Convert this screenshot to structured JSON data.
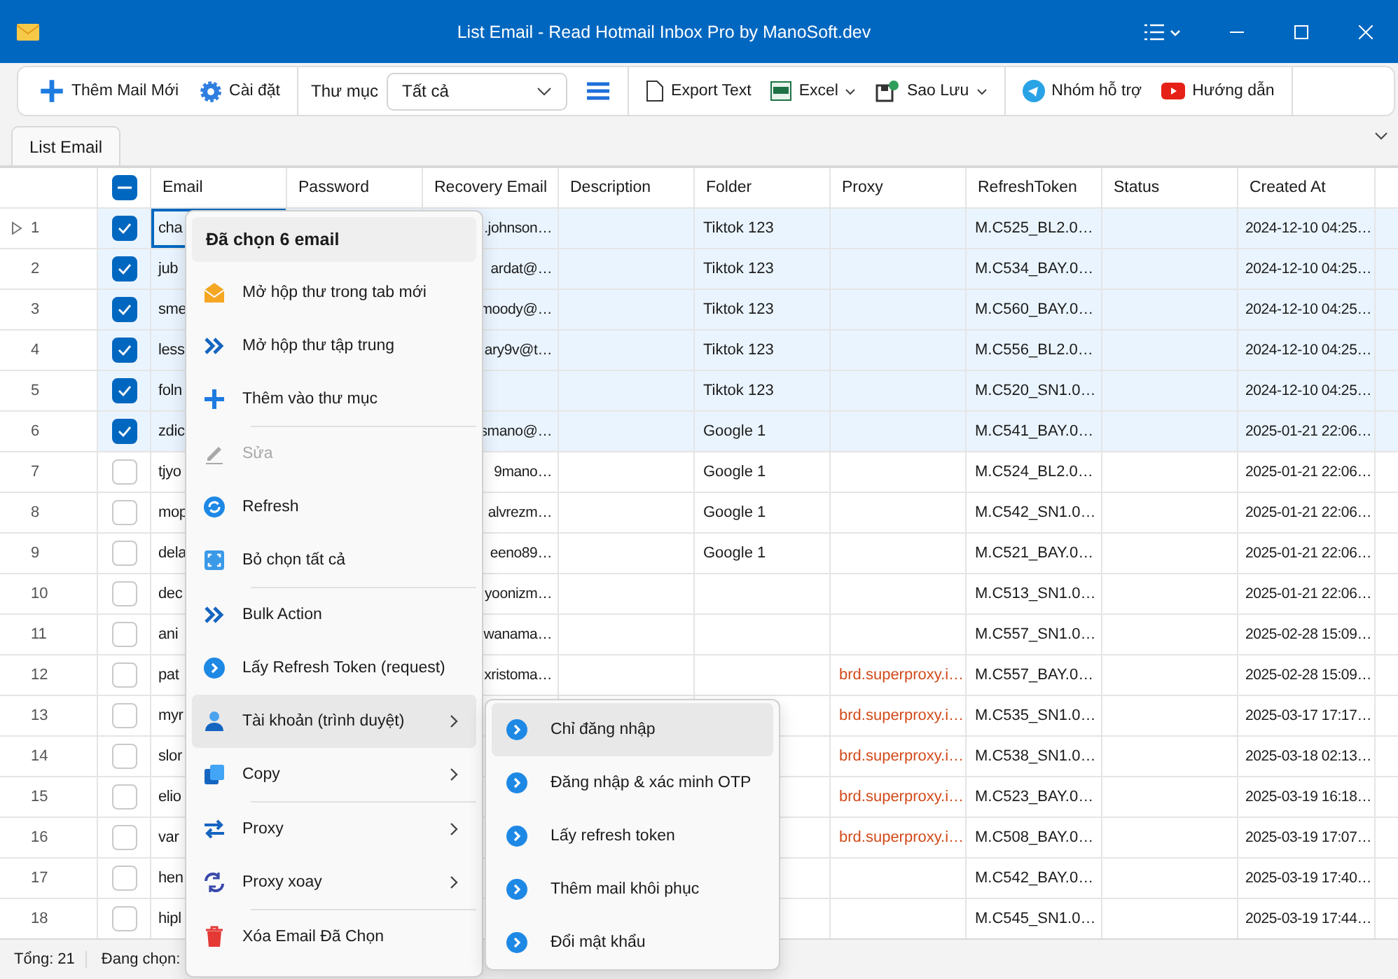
{
  "window": {
    "title": "List Email - Read Hotmail Inbox Pro by ManoSoft.dev"
  },
  "toolbar": {
    "add_button": "Thêm Mail Mới",
    "settings_button": "Cài đặt",
    "folder_label": "Thư mục",
    "folder_select": "Tất cả",
    "export_text": "Export Text",
    "excel": "Excel",
    "backup": "Sao Lưu",
    "support": "Nhóm hỗ trợ",
    "guide": "Hướng dẫn"
  },
  "tabs": [
    {
      "label": "List Email",
      "selected": true
    }
  ],
  "table": {
    "header_checkbox_indeterminate": true,
    "columns": [
      "Email",
      "Password",
      "Recovery Email",
      "Description",
      "Folder",
      "Proxy",
      "RefreshToken",
      "Status",
      "Created At"
    ],
    "rows": [
      {
        "number": "1",
        "current": true,
        "checked": true,
        "email": "cha",
        "recovery_email": ".johnson…",
        "folder": "Tiktok 123",
        "refresh_token": "M.C525_BL2.0…",
        "created_at": "2024-12-10 04:25…"
      },
      {
        "number": "2",
        "current": false,
        "checked": true,
        "email": "jub",
        "recovery_email": "ardat@…",
        "folder": "Tiktok 123",
        "refresh_token": "M.C534_BAY.0…",
        "created_at": "2024-12-10 04:25…"
      },
      {
        "number": "3",
        "current": false,
        "checked": true,
        "email": "sme",
        "recovery_email": "moody@…",
        "folder": "Tiktok 123",
        "refresh_token": "M.C560_BAY.0…",
        "created_at": "2024-12-10 04:25…"
      },
      {
        "number": "4",
        "current": false,
        "checked": true,
        "email": "less",
        "recovery_email": "ary9v@t…",
        "folder": "Tiktok 123",
        "refresh_token": "M.C556_BL2.0…",
        "created_at": "2024-12-10 04:25…"
      },
      {
        "number": "5",
        "current": false,
        "checked": true,
        "email": "foln",
        "folder": "Tiktok 123",
        "refresh_token": "M.C520_SN1.0…",
        "created_at": "2024-12-10 04:25…"
      },
      {
        "number": "6",
        "current": false,
        "checked": true,
        "email": "zdic",
        "recovery_email": "smano@…",
        "folder": "Google 1",
        "refresh_token": "M.C541_BAY.0…",
        "created_at": "2025-01-21 22:06…"
      },
      {
        "number": "7",
        "current": false,
        "checked": false,
        "email": "tjyo",
        "recovery_email": "9mano…",
        "folder": "Google 1",
        "refresh_token": "M.C524_BL2.0…",
        "created_at": "2025-01-21 22:06…"
      },
      {
        "number": "8",
        "current": false,
        "checked": false,
        "email": "mop",
        "recovery_email": "alvrezm…",
        "folder": "Google 1",
        "refresh_token": "M.C542_SN1.0…",
        "created_at": "2025-01-21 22:06…"
      },
      {
        "number": "9",
        "current": false,
        "checked": false,
        "email": "dela",
        "recovery_email": "eeno89…",
        "folder": "Google 1",
        "refresh_token": "M.C521_BAY.0…",
        "created_at": "2025-01-21 22:06…"
      },
      {
        "number": "10",
        "current": false,
        "checked": false,
        "email": "dec",
        "recovery_email": "yoonizm…",
        "refresh_token": "M.C513_SN1.0…",
        "created_at": "2025-01-21 22:06…"
      },
      {
        "number": "11",
        "current": false,
        "checked": false,
        "email": "ani",
        "recovery_email": "wanama…",
        "refresh_token": "M.C557_SN1.0…",
        "created_at": "2025-02-28 15:09…"
      },
      {
        "number": "12",
        "current": false,
        "checked": false,
        "email": "pat",
        "recovery_email": "xristoma…",
        "proxy": "brd.superproxy.i…",
        "refresh_token": "M.C557_BAY.0…",
        "created_at": "2025-02-28 15:09…"
      },
      {
        "number": "13",
        "current": false,
        "checked": false,
        "email": "myr",
        "proxy": "brd.superproxy.i…",
        "refresh_token": "M.C535_SN1.0…",
        "created_at": "2025-03-17 17:17…"
      },
      {
        "number": "14",
        "current": false,
        "checked": false,
        "email": "slor",
        "proxy": "brd.superproxy.i…",
        "refresh_token": "M.C538_SN1.0…",
        "created_at": "2025-03-18 02:13…"
      },
      {
        "number": "15",
        "current": false,
        "checked": false,
        "email": "elio",
        "proxy": "brd.superproxy.i…",
        "refresh_token": "M.C523_BAY.0…",
        "created_at": "2025-03-19 16:18…"
      },
      {
        "number": "16",
        "current": false,
        "checked": false,
        "email": "var",
        "proxy": "brd.superproxy.i…",
        "refresh_token": "M.C508_BAY.0…",
        "created_at": "2025-03-19 17:07…"
      },
      {
        "number": "17",
        "current": false,
        "checked": false,
        "email": "hen",
        "refresh_token": "M.C542_BAY.0…",
        "created_at": "2025-03-19 17:40…"
      },
      {
        "number": "18",
        "current": false,
        "checked": false,
        "email": "hipl",
        "refresh_token": "M.C545_SN1.0…",
        "created_at": "2025-03-19 17:44…"
      }
    ]
  },
  "status_bar": {
    "total": "Tổng: 21",
    "selected": "Đang chọn:"
  },
  "context_menu": {
    "header": "Đã chọn 6 email",
    "items": [
      {
        "kind": "item",
        "label": "Mở hộp thư trong tab mới",
        "disabled": false,
        "selected": false,
        "submenu": false
      },
      {
        "kind": "item",
        "label": "Mở hộp thư tập trung",
        "disabled": false,
        "selected": false,
        "submenu": false
      },
      {
        "kind": "item",
        "label": "Thêm vào thư mục",
        "disabled": false,
        "selected": false,
        "submenu": false
      },
      {
        "kind": "separator"
      },
      {
        "kind": "item",
        "label": "Sửa",
        "disabled": true,
        "selected": false,
        "submenu": false
      },
      {
        "kind": "item",
        "label": "Refresh",
        "disabled": false,
        "selected": false,
        "submenu": false
      },
      {
        "kind": "item",
        "label": "Bỏ chọn tất cả",
        "disabled": false,
        "selected": false,
        "submenu": false
      },
      {
        "kind": "separator"
      },
      {
        "kind": "item",
        "label": "Bulk Action",
        "disabled": false,
        "selected": false,
        "submenu": false
      },
      {
        "kind": "item",
        "label": "Lấy Refresh Token (request)",
        "disabled": false,
        "selected": false,
        "submenu": false
      },
      {
        "kind": "item",
        "label": "Tài khoản (trình duyệt)",
        "disabled": false,
        "selected": true,
        "submenu": true
      },
      {
        "kind": "item",
        "label": "Copy",
        "disabled": false,
        "selected": false,
        "submenu": true
      },
      {
        "kind": "separator"
      },
      {
        "kind": "item",
        "label": "Proxy",
        "disabled": false,
        "selected": false,
        "submenu": true
      },
      {
        "kind": "item",
        "label": "Proxy xoay",
        "disabled": false,
        "selected": false,
        "submenu": true
      },
      {
        "kind": "separator"
      },
      {
        "kind": "item",
        "label": "Xóa Email Đã Chọn",
        "disabled": false,
        "selected": false,
        "submenu": false
      }
    ]
  },
  "submenu": {
    "items": [
      {
        "label": "Chỉ đăng nhập",
        "selected": true
      },
      {
        "label": "Đăng nhập & xác minh OTP",
        "selected": false
      },
      {
        "label": "Lấy refresh token",
        "selected": false
      },
      {
        "label": "Thêm mail khôi phục",
        "selected": false
      },
      {
        "label": "Đổi mật khẩu",
        "selected": false
      }
    ]
  }
}
